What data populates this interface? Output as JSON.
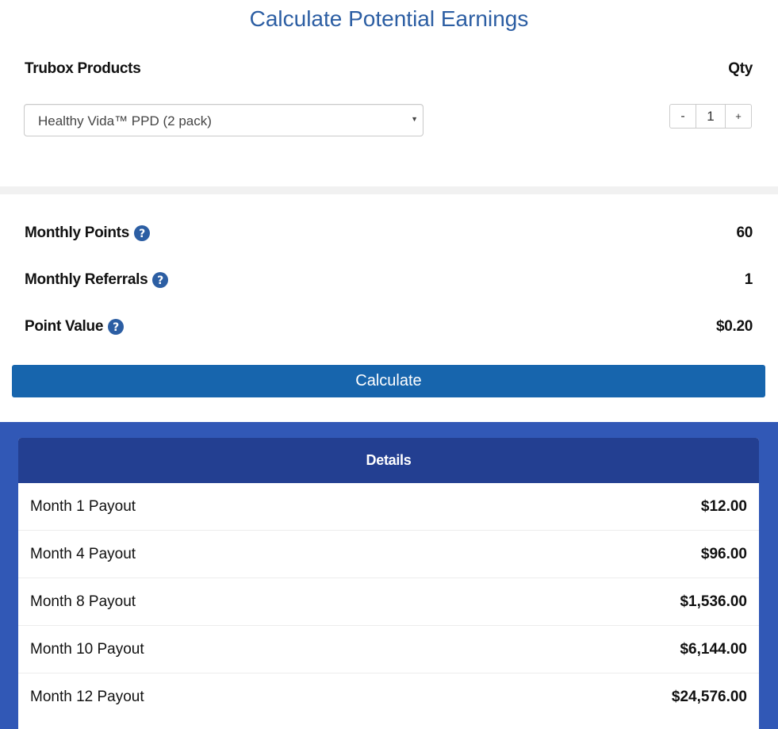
{
  "title": "Calculate Potential Earnings",
  "products": {
    "label": "Trubox Products",
    "selected": "Healthy Vida™ PPD (2 pack)"
  },
  "quantity": {
    "label": "Qty",
    "minus": "-",
    "value": "1",
    "plus": "+"
  },
  "metrics": [
    {
      "label": "Monthly Points",
      "value": "60"
    },
    {
      "label": "Monthly Referrals",
      "value": "1"
    },
    {
      "label": "Point Value",
      "value": "$0.20"
    }
  ],
  "calculate_label": "Calculate",
  "details": {
    "header": "Details",
    "rows": [
      {
        "label": "Month 1 Payout",
        "value": "$12.00"
      },
      {
        "label": "Month 4 Payout",
        "value": "$96.00"
      },
      {
        "label": "Month 8 Payout",
        "value": "$1,536.00"
      },
      {
        "label": "Month 10 Payout",
        "value": "$6,144.00"
      },
      {
        "label": "Month 12 Payout",
        "value": "$24,576.00"
      }
    ]
  },
  "colors": {
    "title": "#2c5ea3",
    "help_icon": "#2c5ea3",
    "calculate_button": "#1765ad",
    "details_background": "#3158b6",
    "details_header": "#233f91"
  },
  "icons": {
    "help": "question-circle-icon",
    "dropdown": "chevron-down-icon"
  }
}
